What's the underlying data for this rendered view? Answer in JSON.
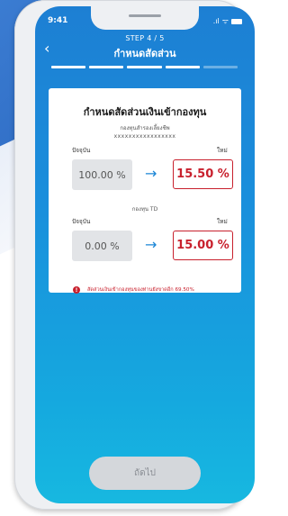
{
  "status": {
    "time": "9:41",
    "signal": ".ıl",
    "wifi": "ᯤ"
  },
  "header": {
    "step": "STEP 4 / 5",
    "title": "กำหนดสัดส่วน",
    "progress_steps": 5,
    "progress_current": 4
  },
  "card": {
    "title": "กำหนดสัดส่วนเงินเข้ากองทุน",
    "funds": [
      {
        "name": "กองทุนสำรองเลี้ยงชีพ",
        "account": "xxxxxxxxxxxxxxxxx",
        "current_label": "ปัจจุบัน",
        "new_label": "ใหม่",
        "current_value": "100.00  %",
        "new_value": "15.50 %"
      },
      {
        "name": "กองทุน TD",
        "current_label": "ปัจจุบัน",
        "new_label": "ใหม่",
        "current_value": "0.00  %",
        "new_value": "15.00 %"
      }
    ],
    "warning": "สัดส่วนเงินเข้ากองทุนของท่านยังขาดอีก 69.50%"
  },
  "footer": {
    "next_label": "ถัดไป"
  },
  "colors": {
    "primary": "#1c86d6",
    "danger": "#c8202d",
    "disabled": "#d4d7db"
  }
}
